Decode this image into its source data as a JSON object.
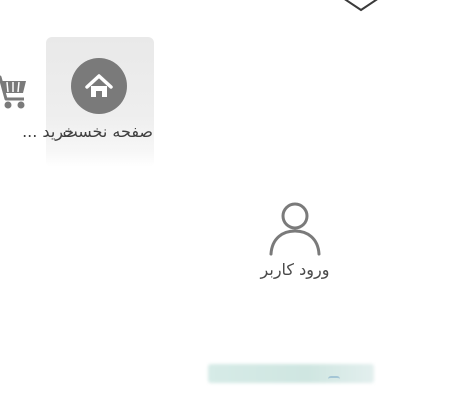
{
  "nav": {
    "home_label": "صفحه نخست",
    "cart_label": "خرید ..."
  },
  "account": {
    "login_label": "ورود کاربر"
  },
  "icons": {
    "home": "home-icon",
    "cart": "cart-icon",
    "user": "user-icon",
    "logo": "logo-icon"
  },
  "colors": {
    "icon_gray": "#7a7a7a",
    "tile_bg": "#eeeeee",
    "accent_teal": "#cfe6e1"
  }
}
